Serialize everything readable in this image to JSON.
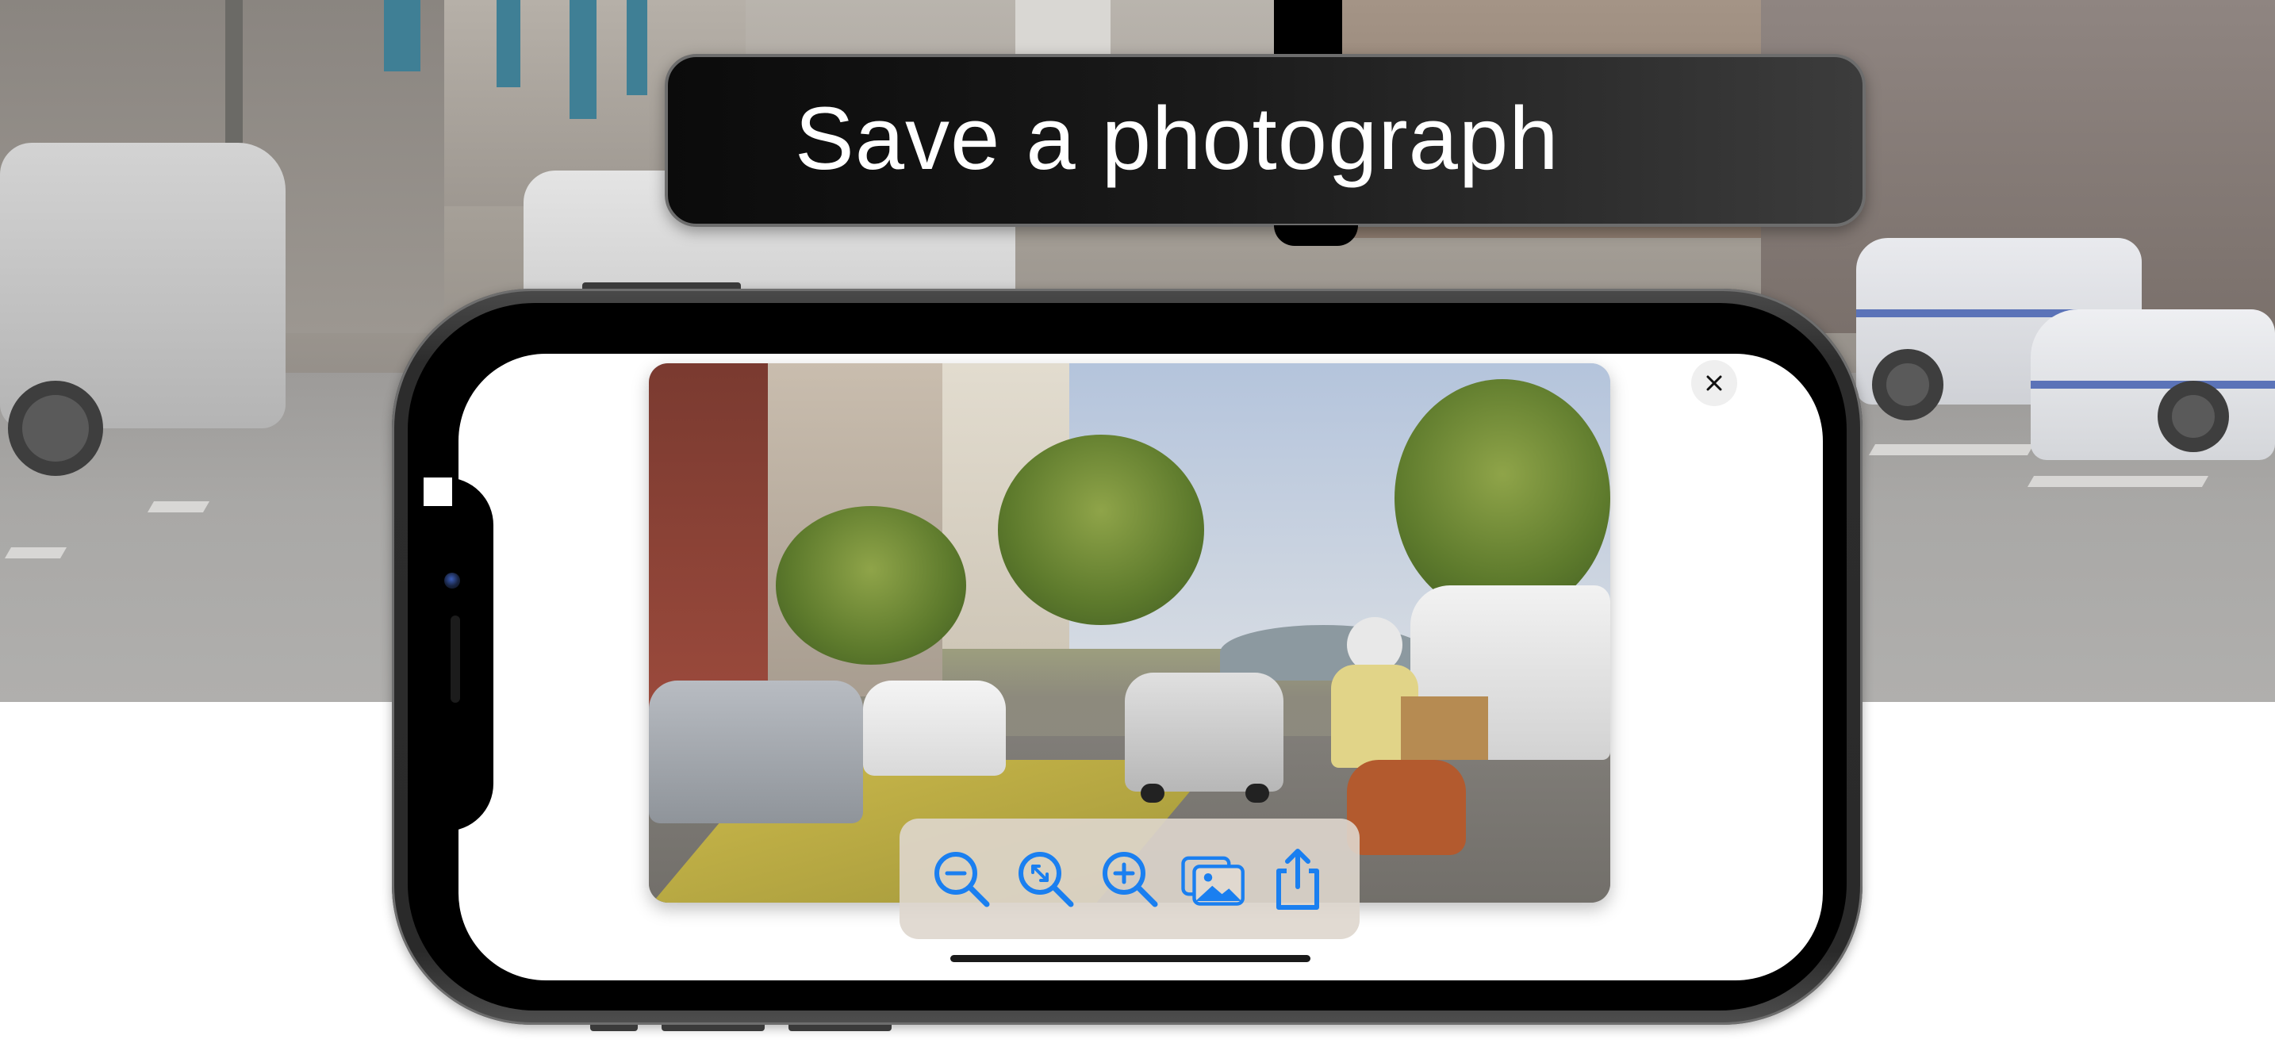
{
  "banner": {
    "title": "Save a photograph"
  },
  "photo_viewer": {
    "controls": [
      {
        "icon": "zoom-out-icon"
      },
      {
        "icon": "zoom-fit-icon"
      },
      {
        "icon": "zoom-in-icon"
      },
      {
        "icon": "photo-library-icon"
      },
      {
        "icon": "share-icon"
      }
    ],
    "close_icon": "close-icon",
    "accent_color": "#1a7ff0"
  }
}
